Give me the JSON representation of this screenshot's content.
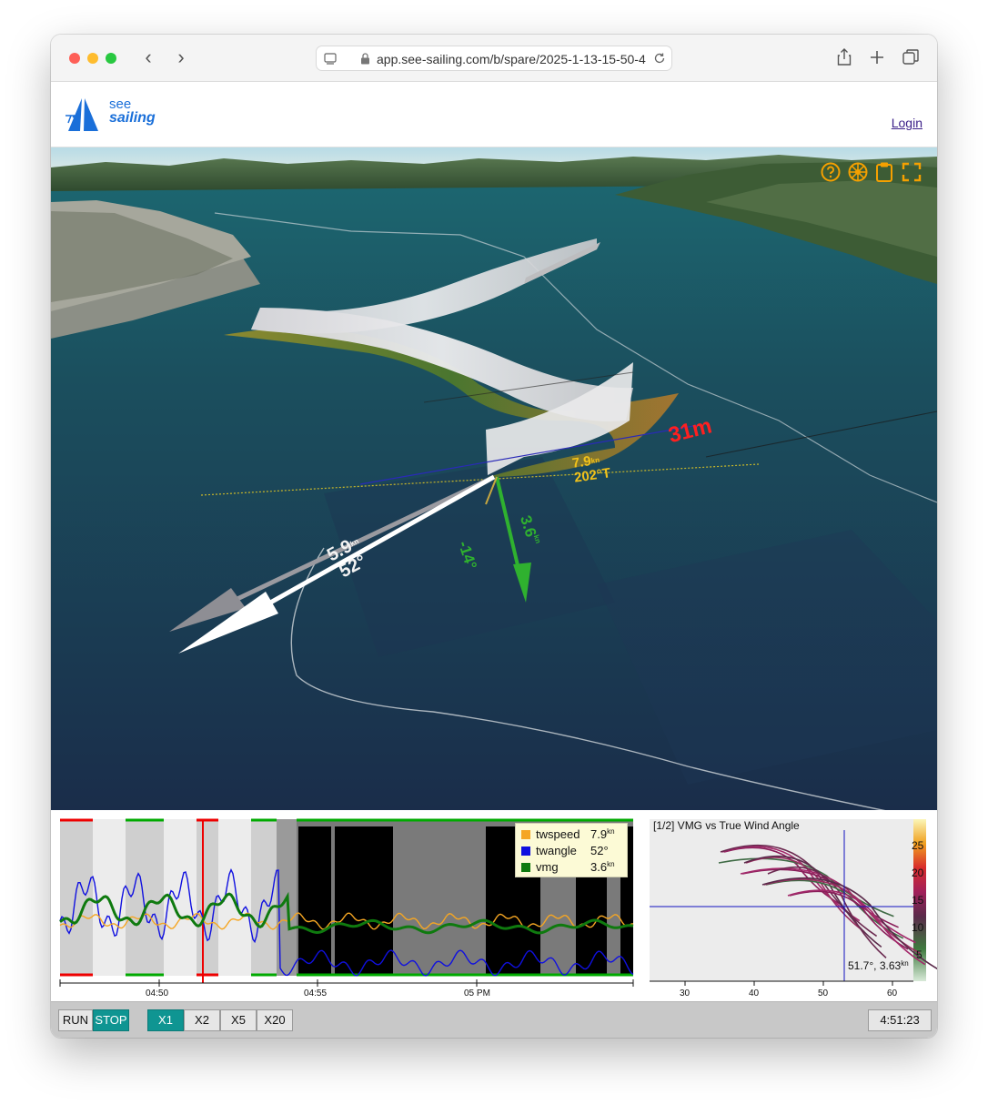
{
  "browser": {
    "url": "app.see-sailing.com/b/spare/2025-1-13-15-50-4"
  },
  "header": {
    "logo_line1": "see",
    "logo_line2": "sailing",
    "login_label": "Login"
  },
  "scene": {
    "distance_label": "31m",
    "wind_speed": "7.9",
    "wind_speed_unit": "kn",
    "wind_dir": "202°T",
    "boat_speed": "5.9",
    "boat_speed_unit": "kn",
    "boat_angle": "52°",
    "vmg_speed": "3.6",
    "vmg_speed_unit": "kn",
    "vmg_angle": "-14°",
    "toolbar_icons": [
      "help-icon",
      "wheel-icon",
      "clipboard-icon",
      "fullscreen-icon"
    ],
    "accent_color": "#f5a000"
  },
  "timeseries": {
    "legend": [
      {
        "name": "twspeed",
        "value": "7.9",
        "unit": "kn",
        "color": "#f5a623"
      },
      {
        "name": "twangle",
        "value": "52°",
        "unit": "",
        "color": "#1010e0"
      },
      {
        "name": "vmg",
        "value": "3.6",
        "unit": "kn",
        "color": "#0f7a0f"
      }
    ],
    "time_ticks": [
      "04:50",
      "04:55",
      "05 PM"
    ]
  },
  "vmg_plot": {
    "title": "[1/2] VMG vs True Wind Angle",
    "x_ticks": [
      "30",
      "40",
      "50",
      "60"
    ],
    "colorbar_ticks": [
      "25",
      "20",
      "15",
      "10",
      "5"
    ],
    "readout_value": "51.7°, 3.63",
    "readout_unit": "kn"
  },
  "controls": {
    "run": "RUN",
    "stop": "STOP",
    "speeds": [
      "X1",
      "X2",
      "X5",
      "X20"
    ],
    "active_speed": "X1",
    "clock": "4:51:23"
  }
}
